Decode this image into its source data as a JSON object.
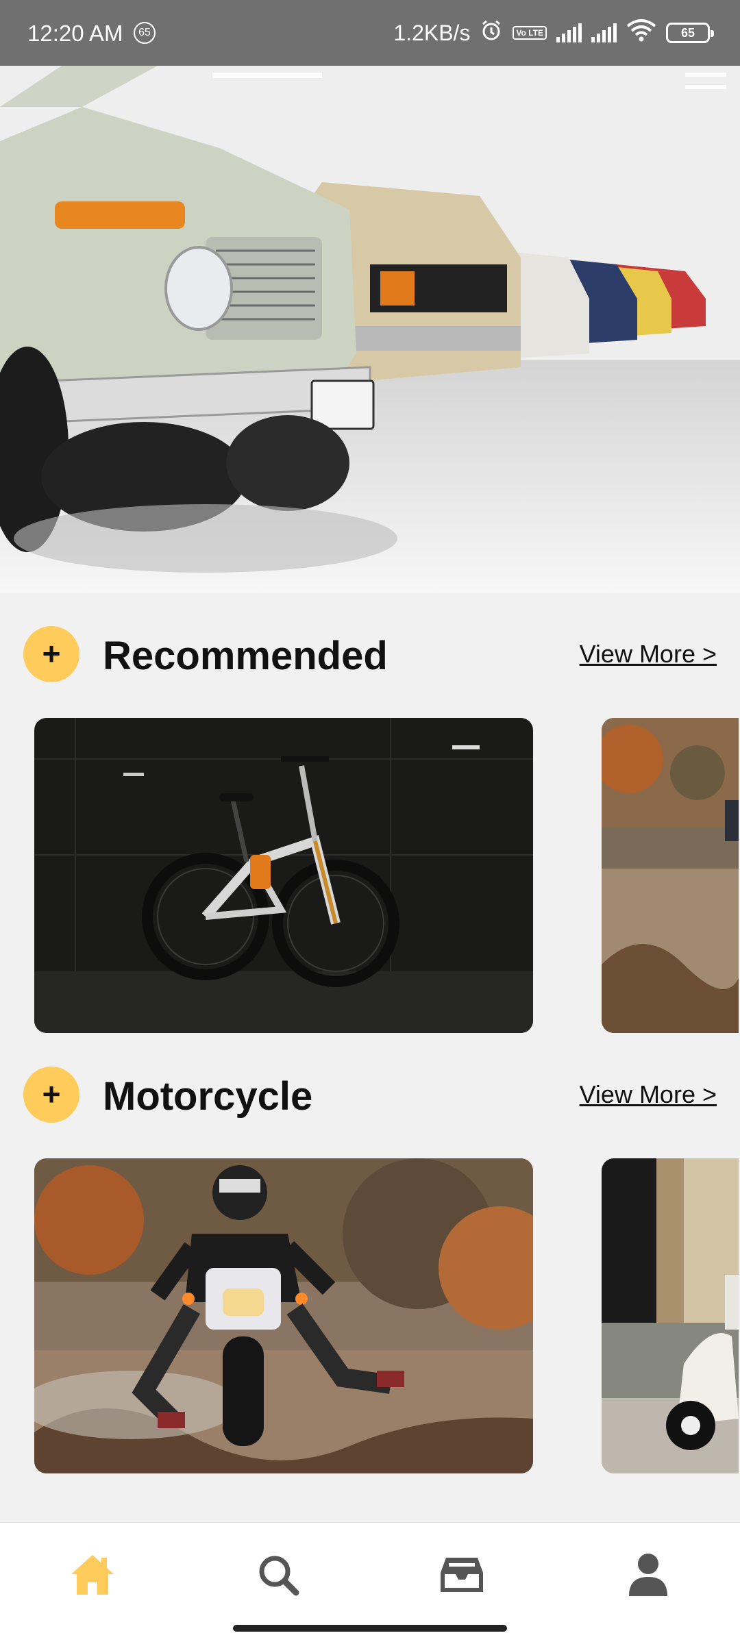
{
  "status_bar": {
    "time": "12:20 AM",
    "notification_count": "65",
    "network_speed": "1.2KB/s",
    "volte_label": "Vo LTE",
    "battery": "65",
    "icons": [
      "alarm-icon",
      "volte-icon",
      "signal-icon",
      "signal-icon",
      "wifi-icon",
      "battery-icon"
    ]
  },
  "hero": {
    "alt": "Classic cars lined up in showroom"
  },
  "sections": [
    {
      "title": "Recommended",
      "view_more": "View More >",
      "items": [
        "mountain-bike",
        "dirt-bike"
      ]
    },
    {
      "title": "Motorcycle",
      "view_more": "View More >",
      "items": [
        "dirt-bike-rider",
        "scooter"
      ]
    }
  ],
  "bottom_nav": {
    "items": [
      "home-icon",
      "search-icon",
      "inbox-icon",
      "profile-icon"
    ],
    "active": "home-icon",
    "active_color": "#ffcc5c",
    "inactive_color": "#555555"
  },
  "colors": {
    "accent": "#ffcc5c",
    "background": "#f1f1f1"
  }
}
